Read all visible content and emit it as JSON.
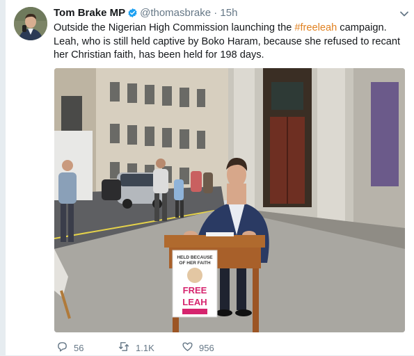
{
  "tweet": {
    "author_name": "Tom Brake MP",
    "handle": "@thomasbrake",
    "separator": "·",
    "time": "15h",
    "text_before_hashtag": "Outside the Nigerian High Commission launching the ",
    "hashtag": "#freeleah",
    "text_after_hashtag": " campaign. Leah, who is still held captive by Boko Haram,  because she refused to recant her Christian faith, has been held for 198 days."
  },
  "photo": {
    "sign_lines": [
      "HELD BECAUSE",
      "OF HER FAITH"
    ],
    "sign_free": "FREE",
    "sign_leah": "LEAH"
  },
  "actions": {
    "replies": "56",
    "retweets": "1.1K",
    "likes": "956"
  },
  "colors": {
    "hashtag": "#e0801f",
    "verified": "#1da1f2",
    "text": "#14171a",
    "muted": "#657786"
  },
  "icons": [
    "verified-badge-icon",
    "chevron-down-icon",
    "reply-icon",
    "retweet-icon",
    "like-icon"
  ]
}
